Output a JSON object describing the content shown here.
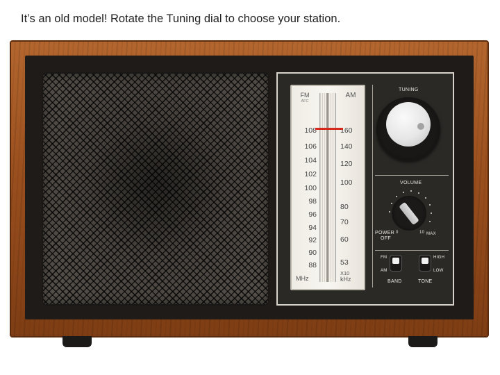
{
  "instruction": "It’s an old model! Rotate the Tuning dial to choose your station.",
  "dial": {
    "fm_label": "FM",
    "afc_label": "AFC",
    "am_label": "AM",
    "fm_scale": [
      "108",
      "106",
      "104",
      "102",
      "100",
      "98",
      "96",
      "94",
      "92",
      "90",
      "88"
    ],
    "am_scale": [
      "160",
      "140",
      "120",
      "100",
      "80",
      "70",
      "60",
      "53"
    ],
    "fm_unit": "MHz",
    "am_unit_top": "X10",
    "am_unit_bottom": "kHz"
  },
  "controls": {
    "tuning_label": "TUNING",
    "volume_label": "VOLUME",
    "power_label": "POWER",
    "off_label": "OFF",
    "max_label": "MAX",
    "fm_switch_label": "FM",
    "am_switch_label": "AM",
    "band_label": "BAND",
    "high_label": "HIGH",
    "low_label": "LOW",
    "tone_label": "TONE",
    "vol_zero": "0",
    "vol_ten": "10"
  },
  "colors": {
    "wood": "#9a4f1e",
    "needle": "#d42a1e",
    "panel": "#2b2926"
  }
}
